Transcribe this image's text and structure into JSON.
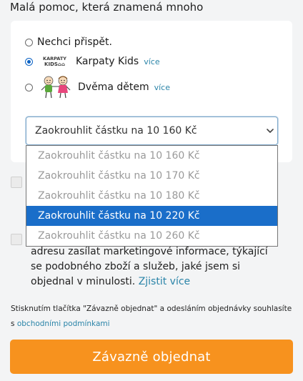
{
  "heading": "Malá pomoc, která znamená mnoho",
  "donation": {
    "options": [
      {
        "label": "Nechci přispět.",
        "checked": false
      },
      {
        "label": "Karpaty Kids",
        "more": "více",
        "checked": true
      },
      {
        "label": "Dvěma dětem",
        "more": "více",
        "checked": false
      }
    ],
    "select_value": "Zaokrouhlit částku na 10 160 Kč",
    "dropdown_options": [
      "Zaokrouhlit částku na 10 160 Kč",
      "Zaokrouhlit částku na 10 170 Kč",
      "Zaokrouhlit částku na 10 180 Kč",
      "Zaokrouhlit částku na 10 220 Kč",
      "Zaokrouhlit částku na 10 260 Kč"
    ],
    "highlighted_option_index": 3
  },
  "consent": {
    "text": "adresu zasílat marketingové informace, týkající se podobného zboží a služeb, jaké jsem si objednal v minulosti.",
    "link": "Zjistit více"
  },
  "terms": {
    "text": "Stisknutím tlačítka \"Závazně objednat\" a odesláním objednávky souhlasíte s",
    "link": "obchodními podmínkami"
  },
  "order_button": "Závazně objednat",
  "colors": {
    "accent": "#f7921e",
    "link": "#2a84a8",
    "selection": "#1a6ec9"
  }
}
